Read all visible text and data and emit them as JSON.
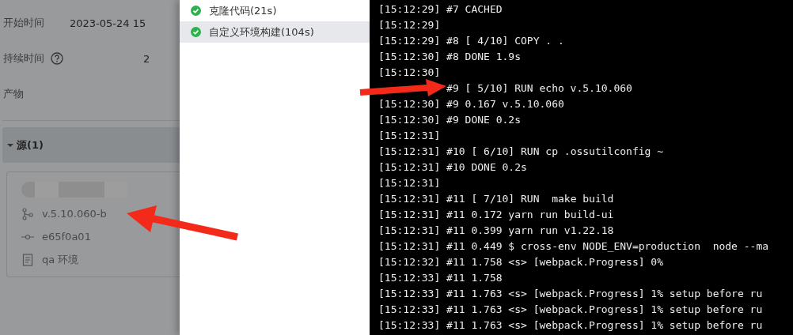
{
  "details": [
    {
      "label": "开始时间",
      "value": "2023-05-24 15",
      "help": false
    },
    {
      "label": "持续时间",
      "value": "2",
      "help": true
    },
    {
      "label": "产物",
      "help": false
    }
  ],
  "sources": {
    "header": "源(1)",
    "expanded": true,
    "rows": [
      {
        "kind": "branch",
        "text": "v.5.10.060-b"
      },
      {
        "kind": "commit",
        "text": "e65f0a01"
      },
      {
        "kind": "file",
        "text": "qa 环境"
      }
    ]
  },
  "steps": [
    {
      "label": "克隆代码(21s)",
      "selected": false
    },
    {
      "label": "自定义环境构建(104s)",
      "selected": true
    }
  ],
  "log": [
    "[15:12:29] #7 CACHED",
    "[15:12:29]",
    "[15:12:29] #8 [ 4/10] COPY . .",
    "[15:12:30] #8 DONE 1.9s",
    "[15:12:30]",
    {
      "text": "#9 [ 5/10] RUN echo v.5.10.060",
      "covered": true
    },
    "[15:12:30] #9 0.167 v.5.10.060",
    "[15:12:30] #9 DONE 0.2s",
    "[15:12:31]",
    "[15:12:31] #10 [ 6/10] RUN cp .ossutilconfig ~",
    "[15:12:31] #10 DONE 0.2s",
    "[15:12:31]",
    "[15:12:31] #11 [ 7/10] RUN  make build",
    "[15:12:31] #11 0.172 yarn run build-ui",
    "[15:12:31] #11 0.399 yarn run v1.22.18",
    "[15:12:31] #11 0.449 $ cross-env NODE_ENV=production  node --ma",
    "[15:12:32] #11 1.758 <s> [webpack.Progress] 0%",
    "[15:12:33] #11 1.758",
    "[15:12:33] #11 1.763 <s> [webpack.Progress] 1% setup before ru",
    "[15:12:33] #11 1.763 <s> [webpack.Progress] 1% setup before ru",
    "[15:12:33] #11 1.763 <s> [webpack.Progress] 1% setup before ru"
  ]
}
